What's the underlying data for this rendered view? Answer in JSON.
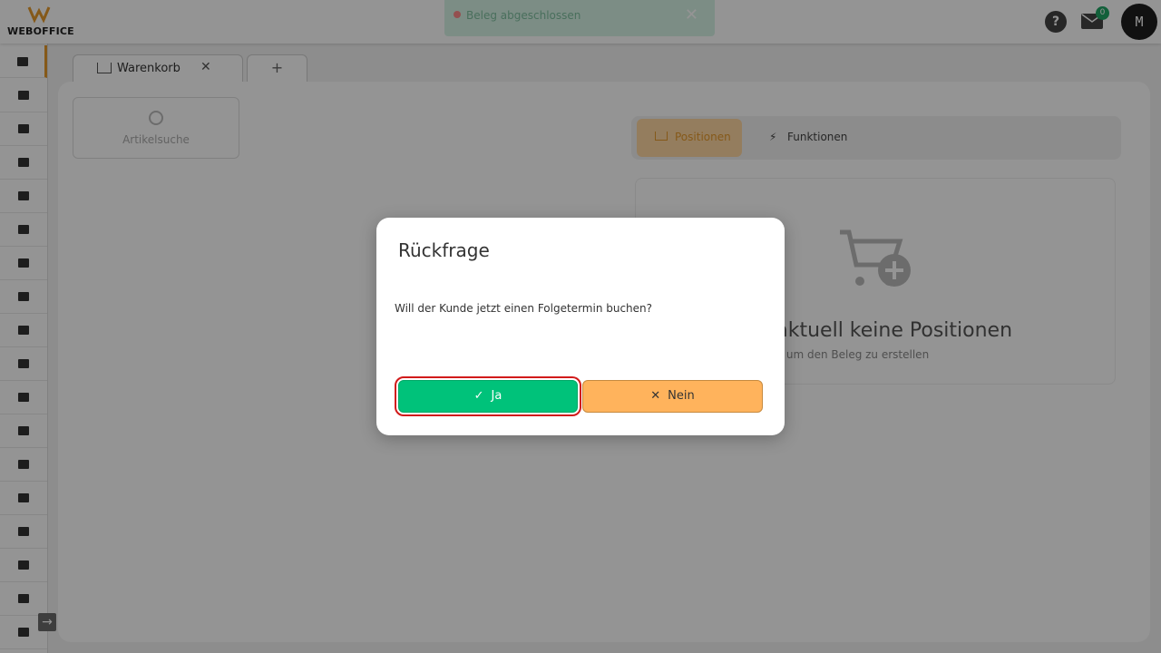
{
  "header": {
    "logo_text": "WEBOFFICE",
    "help_label": "?",
    "mail_count": "0",
    "avatar_initial": "M"
  },
  "toast": {
    "message": "Beleg abgeschlossen",
    "close_symbol": "✕"
  },
  "sidebar": {
    "items": [
      {
        "icon": "cash-register-icon"
      },
      {
        "icon": "calendar-icon"
      },
      {
        "icon": "crown-icon"
      },
      {
        "icon": "network-icon"
      },
      {
        "icon": "clock-icon"
      },
      {
        "icon": "document-icon"
      },
      {
        "icon": "receipt-icon"
      },
      {
        "icon": "boxes-icon"
      },
      {
        "icon": "megaphone-icon"
      },
      {
        "icon": "chart-icon"
      },
      {
        "icon": "folder-icon"
      },
      {
        "icon": "database-icon"
      },
      {
        "icon": "cart-icon"
      },
      {
        "icon": "warehouse-icon"
      },
      {
        "icon": "statistics-icon"
      },
      {
        "icon": "users-icon"
      },
      {
        "icon": "truck-icon"
      },
      {
        "icon": "key-icon"
      }
    ],
    "collapse_symbol": "→"
  },
  "tabs": {
    "items": [
      {
        "label": "Warenkorb",
        "close": "✕"
      }
    ],
    "add_symbol": "+"
  },
  "main": {
    "search_label": "Artikelsuche",
    "position_tabs": [
      "Positionen",
      "Funktionen"
    ],
    "empty_title": "enthält aktuell keine Positionen",
    "empty_subtitle": "ie Artikel hinzu, um den Beleg zu erstellen"
  },
  "dialog": {
    "title": "Rückfrage",
    "message": "Will der Kunde jetzt einen Folgetermin buchen?",
    "yes_label": "Ja",
    "no_label": "Nein",
    "yes_color": "#00c27a",
    "no_color": "#ffb35c"
  }
}
